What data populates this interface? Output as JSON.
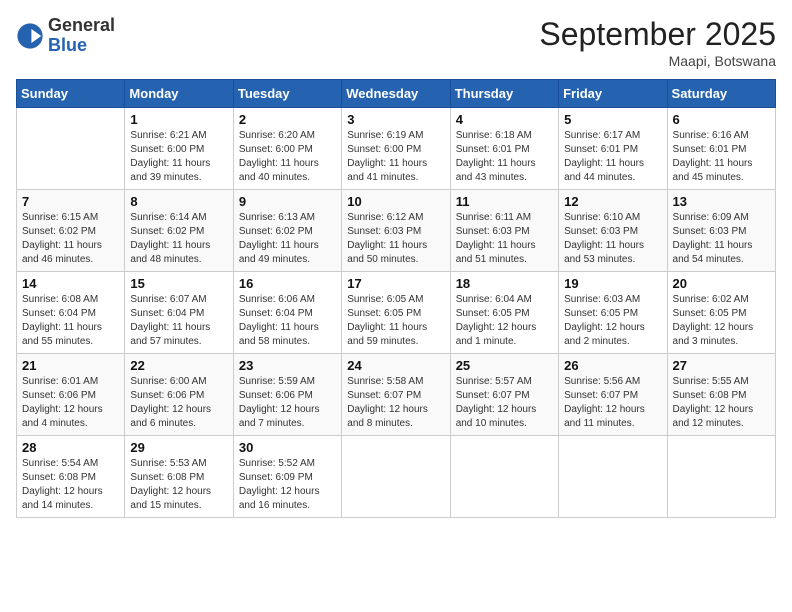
{
  "header": {
    "logo": {
      "general": "General",
      "blue": "Blue"
    },
    "month_title": "September 2025",
    "location": "Maapi, Botswana"
  },
  "weekdays": [
    "Sunday",
    "Monday",
    "Tuesday",
    "Wednesday",
    "Thursday",
    "Friday",
    "Saturday"
  ],
  "weeks": [
    [
      {
        "num": "",
        "info": ""
      },
      {
        "num": "1",
        "info": "Sunrise: 6:21 AM\nSunset: 6:00 PM\nDaylight: 11 hours\nand 39 minutes."
      },
      {
        "num": "2",
        "info": "Sunrise: 6:20 AM\nSunset: 6:00 PM\nDaylight: 11 hours\nand 40 minutes."
      },
      {
        "num": "3",
        "info": "Sunrise: 6:19 AM\nSunset: 6:00 PM\nDaylight: 11 hours\nand 41 minutes."
      },
      {
        "num": "4",
        "info": "Sunrise: 6:18 AM\nSunset: 6:01 PM\nDaylight: 11 hours\nand 43 minutes."
      },
      {
        "num": "5",
        "info": "Sunrise: 6:17 AM\nSunset: 6:01 PM\nDaylight: 11 hours\nand 44 minutes."
      },
      {
        "num": "6",
        "info": "Sunrise: 6:16 AM\nSunset: 6:01 PM\nDaylight: 11 hours\nand 45 minutes."
      }
    ],
    [
      {
        "num": "7",
        "info": "Sunrise: 6:15 AM\nSunset: 6:02 PM\nDaylight: 11 hours\nand 46 minutes."
      },
      {
        "num": "8",
        "info": "Sunrise: 6:14 AM\nSunset: 6:02 PM\nDaylight: 11 hours\nand 48 minutes."
      },
      {
        "num": "9",
        "info": "Sunrise: 6:13 AM\nSunset: 6:02 PM\nDaylight: 11 hours\nand 49 minutes."
      },
      {
        "num": "10",
        "info": "Sunrise: 6:12 AM\nSunset: 6:03 PM\nDaylight: 11 hours\nand 50 minutes."
      },
      {
        "num": "11",
        "info": "Sunrise: 6:11 AM\nSunset: 6:03 PM\nDaylight: 11 hours\nand 51 minutes."
      },
      {
        "num": "12",
        "info": "Sunrise: 6:10 AM\nSunset: 6:03 PM\nDaylight: 11 hours\nand 53 minutes."
      },
      {
        "num": "13",
        "info": "Sunrise: 6:09 AM\nSunset: 6:03 PM\nDaylight: 11 hours\nand 54 minutes."
      }
    ],
    [
      {
        "num": "14",
        "info": "Sunrise: 6:08 AM\nSunset: 6:04 PM\nDaylight: 11 hours\nand 55 minutes."
      },
      {
        "num": "15",
        "info": "Sunrise: 6:07 AM\nSunset: 6:04 PM\nDaylight: 11 hours\nand 57 minutes."
      },
      {
        "num": "16",
        "info": "Sunrise: 6:06 AM\nSunset: 6:04 PM\nDaylight: 11 hours\nand 58 minutes."
      },
      {
        "num": "17",
        "info": "Sunrise: 6:05 AM\nSunset: 6:05 PM\nDaylight: 11 hours\nand 59 minutes."
      },
      {
        "num": "18",
        "info": "Sunrise: 6:04 AM\nSunset: 6:05 PM\nDaylight: 12 hours\nand 1 minute."
      },
      {
        "num": "19",
        "info": "Sunrise: 6:03 AM\nSunset: 6:05 PM\nDaylight: 12 hours\nand 2 minutes."
      },
      {
        "num": "20",
        "info": "Sunrise: 6:02 AM\nSunset: 6:05 PM\nDaylight: 12 hours\nand 3 minutes."
      }
    ],
    [
      {
        "num": "21",
        "info": "Sunrise: 6:01 AM\nSunset: 6:06 PM\nDaylight: 12 hours\nand 4 minutes."
      },
      {
        "num": "22",
        "info": "Sunrise: 6:00 AM\nSunset: 6:06 PM\nDaylight: 12 hours\nand 6 minutes."
      },
      {
        "num": "23",
        "info": "Sunrise: 5:59 AM\nSunset: 6:06 PM\nDaylight: 12 hours\nand 7 minutes."
      },
      {
        "num": "24",
        "info": "Sunrise: 5:58 AM\nSunset: 6:07 PM\nDaylight: 12 hours\nand 8 minutes."
      },
      {
        "num": "25",
        "info": "Sunrise: 5:57 AM\nSunset: 6:07 PM\nDaylight: 12 hours\nand 10 minutes."
      },
      {
        "num": "26",
        "info": "Sunrise: 5:56 AM\nSunset: 6:07 PM\nDaylight: 12 hours\nand 11 minutes."
      },
      {
        "num": "27",
        "info": "Sunrise: 5:55 AM\nSunset: 6:08 PM\nDaylight: 12 hours\nand 12 minutes."
      }
    ],
    [
      {
        "num": "28",
        "info": "Sunrise: 5:54 AM\nSunset: 6:08 PM\nDaylight: 12 hours\nand 14 minutes."
      },
      {
        "num": "29",
        "info": "Sunrise: 5:53 AM\nSunset: 6:08 PM\nDaylight: 12 hours\nand 15 minutes."
      },
      {
        "num": "30",
        "info": "Sunrise: 5:52 AM\nSunset: 6:09 PM\nDaylight: 12 hours\nand 16 minutes."
      },
      {
        "num": "",
        "info": ""
      },
      {
        "num": "",
        "info": ""
      },
      {
        "num": "",
        "info": ""
      },
      {
        "num": "",
        "info": ""
      }
    ]
  ]
}
